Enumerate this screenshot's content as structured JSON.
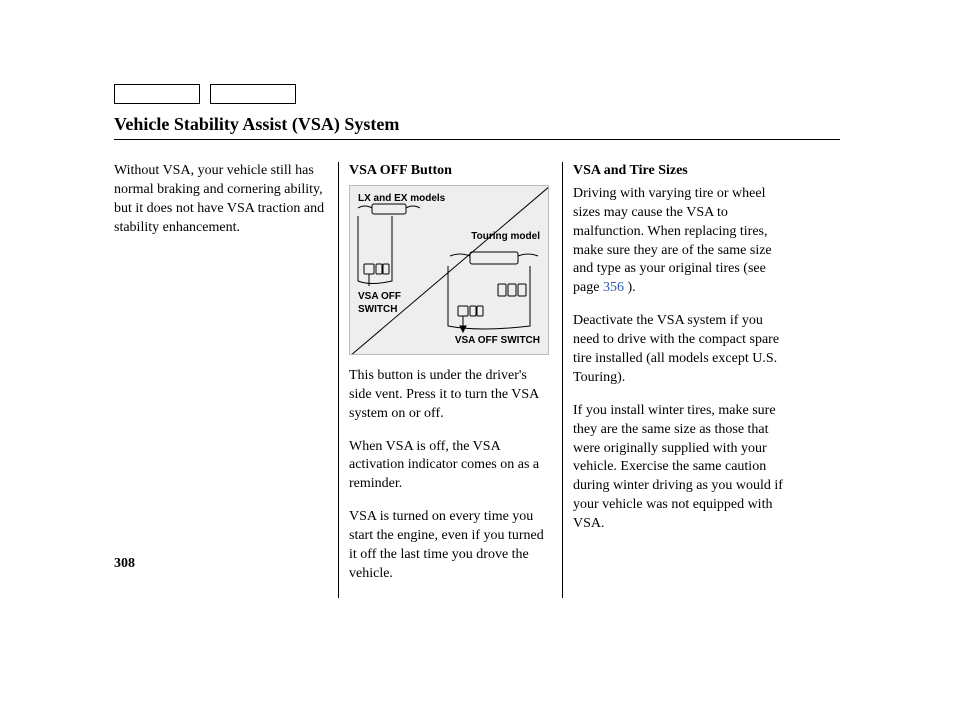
{
  "title": "Vehicle Stability Assist (VSA) System",
  "page_number": "308",
  "col1": {
    "p1": "Without VSA, your vehicle still has normal braking and cornering ability, but it does not have VSA traction and stability enhancement."
  },
  "col2": {
    "heading": "VSA OFF Button",
    "diagram": {
      "label_top": "LX and EX models",
      "label_right": "Touring model",
      "label_left": "VSA OFF SWITCH",
      "label_bottom": "VSA OFF SWITCH"
    },
    "p1": "This button is under the driver's side vent. Press it to turn the VSA system on or off.",
    "p2": "When VSA is off, the VSA activation indicator comes on as a reminder.",
    "p3": "VSA is turned on every time you start the engine, even if you turned it off the last time you drove the vehicle."
  },
  "col3": {
    "heading": "VSA and Tire Sizes",
    "p1a": "Driving with varying tire or wheel sizes may cause the VSA to malfunction. When replacing tires, make sure they are of the same size and type as your original tires (see page ",
    "p1link": "356",
    "p1b": " ).",
    "p2": "Deactivate the VSA system if you need to drive with the compact spare tire installed (all models except U.S. Touring).",
    "p3": "If you install winter tires, make sure they are the same size as those that were originally supplied with your vehicle. Exercise the same caution during winter driving as you would if your vehicle was not equipped with VSA."
  }
}
